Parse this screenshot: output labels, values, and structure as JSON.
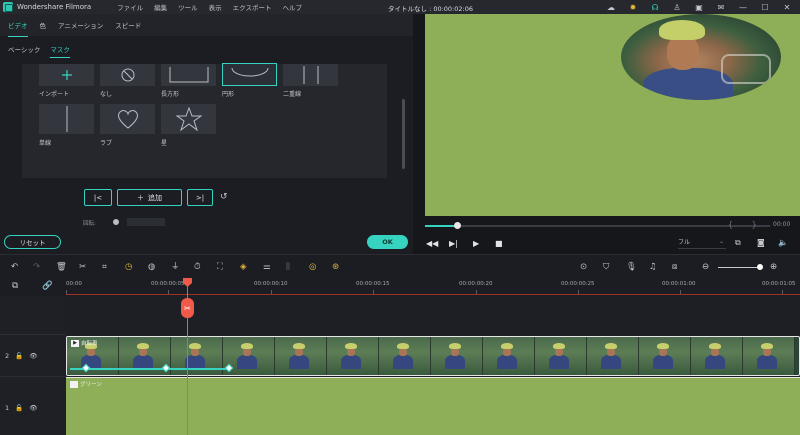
{
  "app": {
    "name": "Wondershare Filmora",
    "doc_title": "タイトルなし : 00:00:02:06"
  },
  "menu": [
    "ファイル",
    "編集",
    "ツール",
    "表示",
    "エクスポート",
    "ヘルプ"
  ],
  "tabs": [
    "ビデオ",
    "色",
    "アニメーション",
    "スピード"
  ],
  "subtabs": [
    "ベーシック",
    "マスク"
  ],
  "mask_tiles": {
    "import": "インポート",
    "none": "なし",
    "rectangle": "長方形",
    "circle": "円形",
    "double_line": "二重線",
    "single_line": "単線",
    "love": "ラブ",
    "star": "星"
  },
  "controls": {
    "add": "追加",
    "rotate_label": "回転:",
    "reset": "リセット",
    "ok": "OK"
  },
  "preview": {
    "quality": "フル",
    "progress_fraction": 0.096,
    "brackets": "{ }"
  },
  "ruler": [
    "00:00",
    "00:00:00:05",
    "00:00:00:10",
    "00:00:00:15",
    "00:00:00:20",
    "00:00:00:25",
    "00:00:01:00",
    "00:00:01:05"
  ],
  "tracks": [
    {
      "number": "2",
      "clip_name": "自転車"
    },
    {
      "number": "1",
      "clip_name": "グリーン"
    }
  ],
  "icons": {
    "top_right": [
      "cloud-icon",
      "lightbulb-icon",
      "headset-icon",
      "user-icon",
      "save-icon",
      "mail-icon",
      "minimize-icon",
      "maximize-icon",
      "close-icon"
    ],
    "toolbar": [
      "undo-icon",
      "redo-icon",
      "delete-icon",
      "cut-icon",
      "crop-icon",
      "speed-icon",
      "color-icon",
      "audio-stretch-icon",
      "timer-icon",
      "fit-icon",
      "keyframe-icon",
      "adjust-icon",
      "split-audio-icon",
      "motion-track-icon",
      "stabilize-icon"
    ]
  },
  "colors": {
    "accent": "#36d3c0",
    "playhead": "#f05a4a",
    "green_screen": "#8fae58"
  }
}
